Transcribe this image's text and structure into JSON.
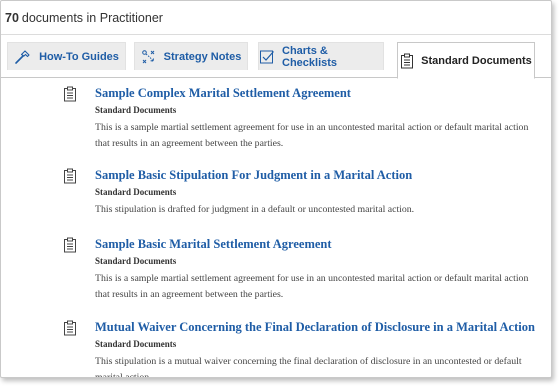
{
  "header": {
    "count": "70",
    "text": "documents in Practitioner"
  },
  "tabs": [
    {
      "label": "How-To Guides",
      "icon": "hammer-icon"
    },
    {
      "label": "Strategy Notes",
      "icon": "strategy-icon"
    },
    {
      "label": "Charts & Checklists",
      "icon": "checklist-icon"
    },
    {
      "label": "Standard Documents",
      "icon": "clipboard-icon",
      "active": true
    }
  ],
  "documents": [
    {
      "title": "Sample Complex Marital Settlement Agreement",
      "type": "Standard Documents",
      "desc_line1": "This is a sample martial settlement agreement for use in an uncontested marital action or default marital action",
      "desc_line2": "that results in an agreement between the parties."
    },
    {
      "title": "Sample Basic Stipulation For Judgment in a Marital Action",
      "type": "Standard Documents",
      "desc_line1": "This stipulation is drafted for judgment in a default or uncontested marital action.",
      "desc_line2": ""
    },
    {
      "title": "Sample Basic Marital Settlement Agreement",
      "type": "Standard Documents",
      "desc_line1": "This is a sample martial settlement agreement for use in an uncontested marital action or default marital action",
      "desc_line2": "that results in an agreement between the parties."
    },
    {
      "title": "Mutual Waiver Concerning the Final Declaration of Disclosure in a Marital Action",
      "type": "Standard Documents",
      "desc_line1": "This stipulation is a mutual waiver concerning the final declaration of disclosure in an uncontested or default",
      "desc_line2": "marital action."
    }
  ],
  "colors": {
    "link": "#1f5da6",
    "tab_bg": "#ececec"
  }
}
